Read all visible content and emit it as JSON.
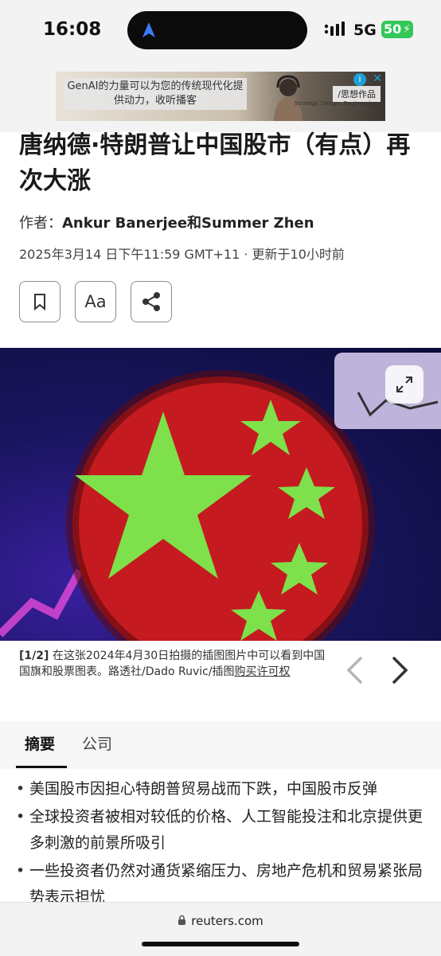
{
  "status": {
    "time": "16:08",
    "network": "5G",
    "battery": "50"
  },
  "ad": {
    "text": "GenAI的力量可以为您的传统现代化提供动力，收听播客",
    "brand": "/思想作品",
    "tagline": "Strategy. Design. Engineering.",
    "info_icon": "info-icon",
    "close_icon": "close-icon"
  },
  "article": {
    "headline": "唐纳德·特朗普让中国股市（有点）再次大涨",
    "byline_prefix": "作者：",
    "authors": "Ankur Banerjee和Summer Zhen",
    "dateline": "2025年3月14 日下午11:59 GMT+11 · 更新于10小时前"
  },
  "actions": {
    "font_button": "Aa"
  },
  "photo": {
    "index": "[1/2]",
    "caption": " 在这张2024年4月30日拍摄的插图图片中可以看到中国国旗和股票图表。路透社/Dado Ruvic/插图",
    "license_link": "购买许可权"
  },
  "tabs": [
    {
      "label": "摘要",
      "active": true
    },
    {
      "label": "公司",
      "active": false
    }
  ],
  "summary": [
    "美国股市因担心特朗普贸易战而下跌，中国股市反弹",
    "全球投资者被相对较低的价格、人工智能投注和北京提供更多刺激的前景所吸引",
    "一些投资者仍然对通货紧缩压力、房地产危机和贸易紧张局势表示担忧"
  ],
  "browser": {
    "url": "reuters.com"
  },
  "colors": {
    "flag_red": "#c5181f",
    "star": "#7ee04a",
    "battery": "#34c759"
  }
}
